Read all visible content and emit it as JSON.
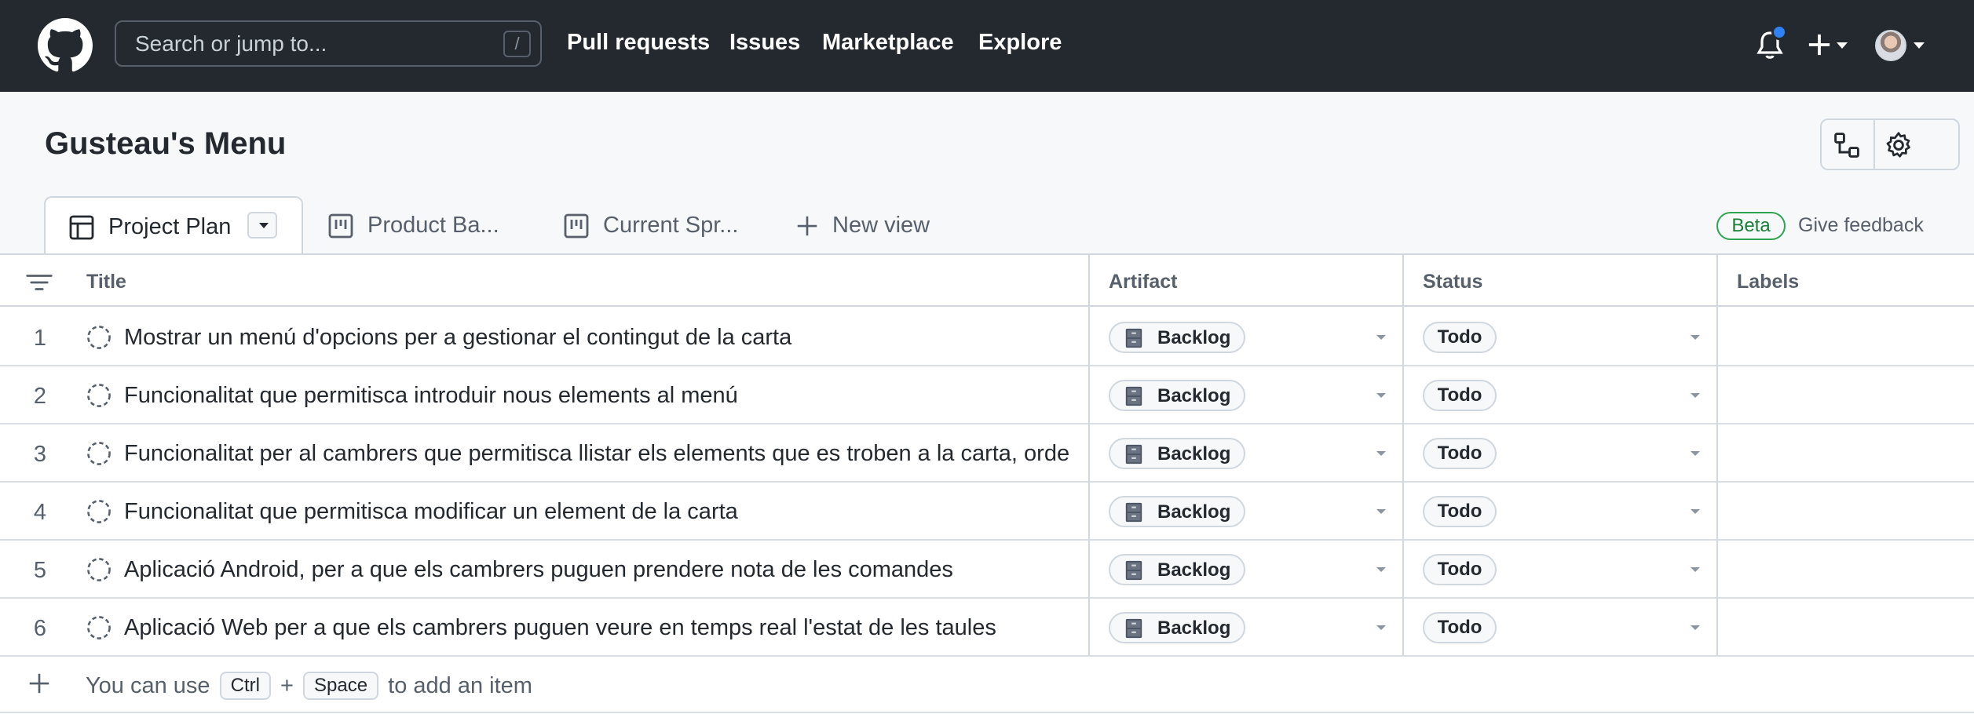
{
  "header": {
    "search_placeholder": "Search or jump to...",
    "search_shortcut": "/",
    "nav": [
      "Pull requests",
      "Issues",
      "Marketplace",
      "Explore"
    ]
  },
  "project": {
    "title": "Gusteau's Menu"
  },
  "views": {
    "tabs": [
      "Project Plan",
      "Product Ba...",
      "Current Spr..."
    ],
    "new_view": "New view",
    "beta": "Beta",
    "feedback": "Give feedback"
  },
  "table": {
    "columns": [
      "Title",
      "Artifact",
      "Status",
      "Labels"
    ],
    "rows": [
      {
        "num": "1",
        "title": "Mostrar un menú d'opcions per a gestionar el contingut de la carta",
        "artifact": "Backlog",
        "status": "Todo"
      },
      {
        "num": "2",
        "title": "Funcionalitat que permitisca introduir nous elements al menú",
        "artifact": "Backlog",
        "status": "Todo"
      },
      {
        "num": "3",
        "title": "Funcionalitat per al cambrers que permitisca llistar els elements que es troben a la carta, ordenats",
        "artifact": "Backlog",
        "status": "Todo"
      },
      {
        "num": "4",
        "title": "Funcionalitat que permitisca modificar un element de la carta",
        "artifact": "Backlog",
        "status": "Todo"
      },
      {
        "num": "5",
        "title": "Aplicació Android, per a que els cambrers puguen prendere nota de les comandes",
        "artifact": "Backlog",
        "status": "Todo"
      },
      {
        "num": "6",
        "title": "Aplicació Web per a que els cambrers puguen veure en temps real l'estat de les taules",
        "artifact": "Backlog",
        "status": "Todo"
      }
    ],
    "add_item": {
      "prefix": "You can use",
      "key1": "Ctrl",
      "plus": "+",
      "key2": "Space",
      "suffix": "to add an item"
    }
  },
  "colors": {
    "header_bg": "#24292f",
    "subheader_bg": "#f6f8fa",
    "accent_blue": "#2f81f7",
    "beta_green": "#1a7f37"
  },
  "icons": [
    "github-logo-icon",
    "bell-icon",
    "plus-icon",
    "workflows-icon",
    "gear-icon",
    "table-icon",
    "board-icon",
    "filter-icon",
    "draft-issue-icon",
    "file-cabinet-icon"
  ]
}
